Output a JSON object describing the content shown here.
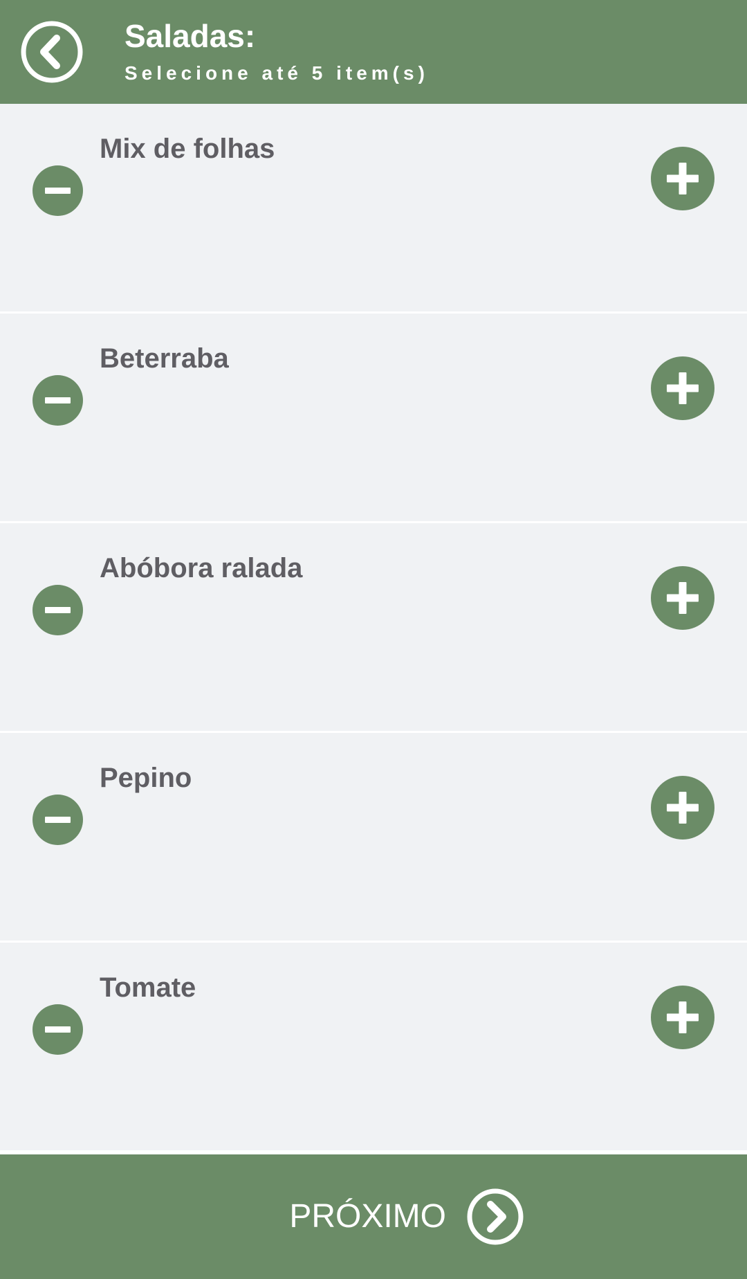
{
  "header": {
    "title": "Saladas:",
    "subtitle": "Selecione até 5 item(s)"
  },
  "items": [
    {
      "name": "Mix de folhas"
    },
    {
      "name": "Beterraba"
    },
    {
      "name": "Abóbora ralada"
    },
    {
      "name": "Pepino"
    },
    {
      "name": "Tomate"
    }
  ],
  "footer": {
    "next_label": "PRÓXIMO"
  },
  "icons": {
    "back": "chevron-left-circle-icon",
    "minus": "minus-circle-icon",
    "plus": "plus-circle-icon",
    "next": "chevron-right-circle-icon"
  },
  "colors": {
    "brand_green": "#6b8c67",
    "row_background": "#f0f2f4",
    "item_text": "#5f5e63",
    "header_text": "#ffffff"
  }
}
